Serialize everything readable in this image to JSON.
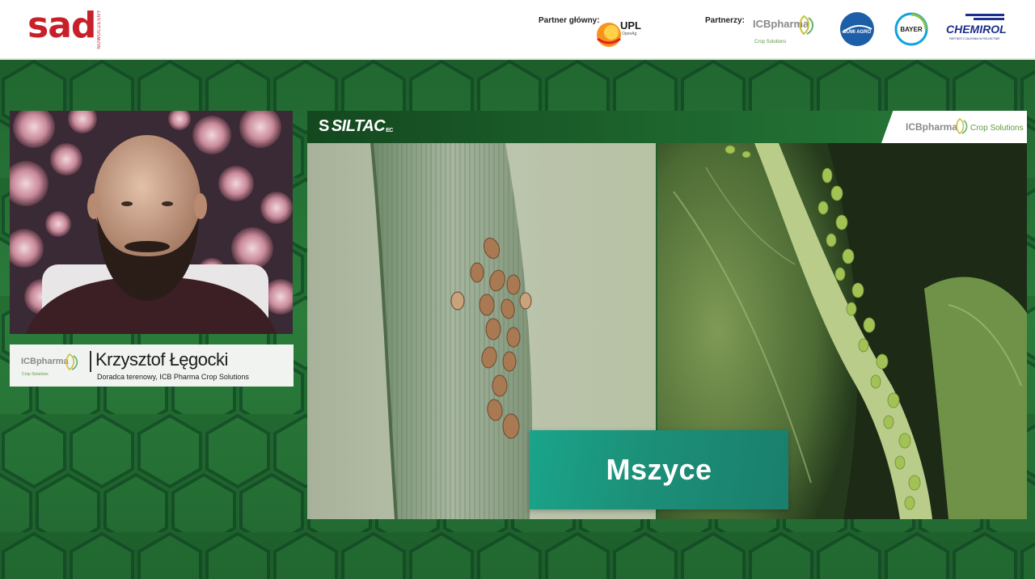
{
  "header": {
    "brand_word": "sad",
    "brand_sub": "NOWOCZESNY",
    "partner_main_label": "Partner główny:",
    "partner_main_name": "UPL",
    "partner_main_tagline": "OpenAg",
    "partners_label": "Partnerzy:",
    "partners": [
      {
        "name": "ICBpharma",
        "tagline": "Crop Solutions"
      },
      {
        "name": "SUMI AGRO"
      },
      {
        "name": "BAYER"
      },
      {
        "name": "CHEMIROL",
        "tagline": "PARTNER Z ZAUFANIA W ROLNICTWIE"
      }
    ]
  },
  "speaker": {
    "logo_name": "ICBpharma",
    "logo_tagline": "Crop Solutions",
    "name": "Krzysztof Łęgocki",
    "role": "Doradca terenowy, ICB Pharma Crop Solutions"
  },
  "panel": {
    "product_name": "SILTAC",
    "product_suffix": "EC",
    "corner_logo_name": "ICBpharma",
    "corner_logo_tagline": "Crop Solutions",
    "caption": "Mszyce"
  },
  "colors": {
    "brand_red": "#c8202a",
    "stage_green": "#246f33",
    "caption_teal": "#1aa48a",
    "upl_orange": "#f7931e"
  }
}
